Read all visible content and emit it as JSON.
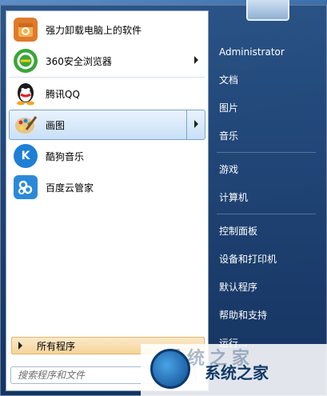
{
  "pinned_apps": [
    {
      "label": "强力卸载电脑上的软件",
      "icon": "uninstall-box-icon",
      "color": "#e07a2b",
      "has_arrow": false
    },
    {
      "label": "360安全浏览器",
      "icon": "360-browser-icon",
      "color": "#3aa63a",
      "has_arrow": true
    },
    {
      "label": "腾讯QQ",
      "icon": "qq-penguin-icon",
      "color": "#1b1b1b",
      "has_arrow": false
    },
    {
      "label": "画图",
      "icon": "paint-palette-icon",
      "color": "#d28b3a",
      "has_arrow": true
    },
    {
      "label": "酷狗音乐",
      "icon": "kugou-music-icon",
      "color": "#1e7fd6",
      "has_arrow": false
    },
    {
      "label": "百度云管家",
      "icon": "baidu-cloud-icon",
      "color": "#2b8ad8",
      "has_arrow": false
    }
  ],
  "selected_app": "画图",
  "all_programs_label": "所有程序",
  "search": {
    "placeholder": "搜索程序和文件"
  },
  "right_pane": {
    "user": "Administrator",
    "items": [
      "文档",
      "图片",
      "音乐",
      "游戏",
      "计算机",
      "控制面板",
      "设备和打印机",
      "默认程序",
      "帮助和支持",
      "运行..."
    ]
  },
  "watermark": {
    "text": "系统之家",
    "ghost_text": "系统之家"
  }
}
